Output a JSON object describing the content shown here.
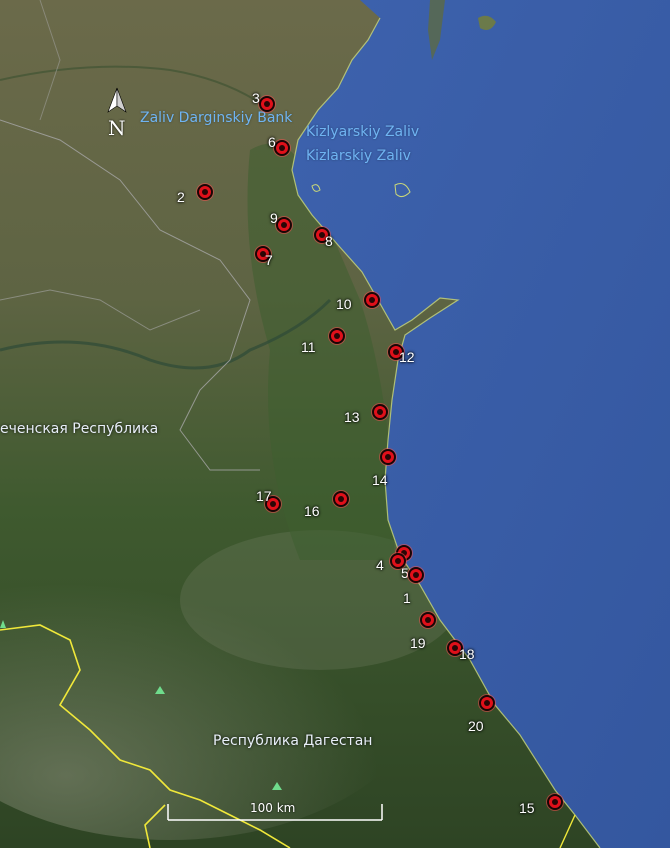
{
  "map": {
    "water_labels": [
      {
        "id": "zaliv-darginskiy",
        "text": "Zaliv Darginskiy Bank"
      },
      {
        "id": "kizlyarskiy-zaliv",
        "text": "Kizlyarskiy Zaliv"
      },
      {
        "id": "kizlarskiy-zaliv",
        "text": "Kizlarskiy Zaliv"
      }
    ],
    "region_labels": [
      {
        "id": "chechen",
        "text": "еченская Республика"
      },
      {
        "id": "dagestan",
        "text": "Республика Дагестан"
      }
    ],
    "north_arrow": {
      "letter": "N"
    },
    "scale": {
      "label": "100 km"
    },
    "sites": [
      {
        "id": "1",
        "label": "1"
      },
      {
        "id": "2",
        "label": "2"
      },
      {
        "id": "3",
        "label": "3"
      },
      {
        "id": "4",
        "label": "4"
      },
      {
        "id": "5",
        "label": "5"
      },
      {
        "id": "6",
        "label": "6"
      },
      {
        "id": "7",
        "label": "7"
      },
      {
        "id": "8",
        "label": "8"
      },
      {
        "id": "9",
        "label": "9"
      },
      {
        "id": "10",
        "label": "10"
      },
      {
        "id": "11",
        "label": "11"
      },
      {
        "id": "12",
        "label": "12"
      },
      {
        "id": "13",
        "label": "13"
      },
      {
        "id": "14",
        "label": "14"
      },
      {
        "id": "15",
        "label": "15"
      },
      {
        "id": "16",
        "label": "16"
      },
      {
        "id": "17",
        "label": "17"
      },
      {
        "id": "18",
        "label": "18"
      },
      {
        "id": "19",
        "label": "19"
      },
      {
        "id": "20",
        "label": "20"
      }
    ],
    "colors": {
      "sea": "#3a5ea8",
      "marker": "#e0101a",
      "border": "#f0e83a",
      "water_label": "#6fb4f2"
    }
  }
}
